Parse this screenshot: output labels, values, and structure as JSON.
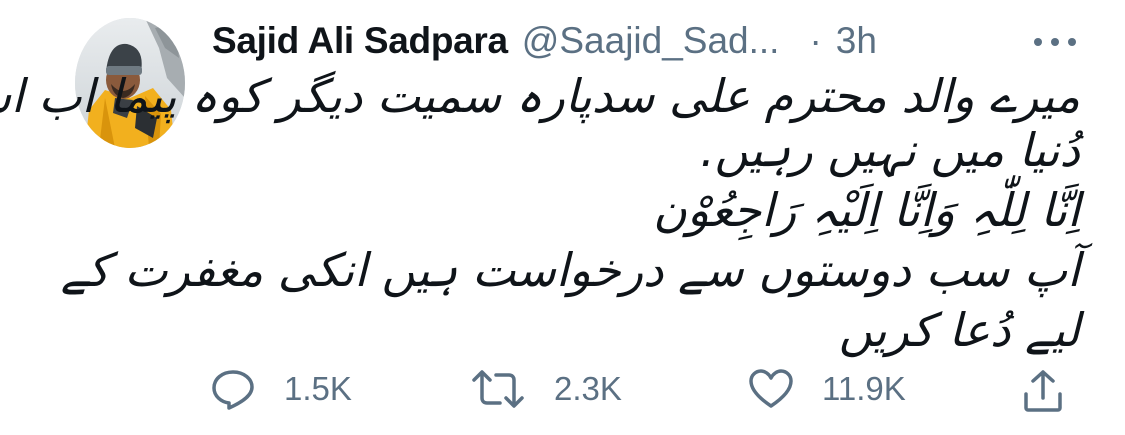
{
  "author": {
    "name": "Sajid Ali Sadpara",
    "handle": "@Saajid_Sad...",
    "separator": "·",
    "time": "3h"
  },
  "more": {
    "icon": "more-icon",
    "label": "•••"
  },
  "tweet": {
    "lines": [
      "میرے والد محترم علی سدپارہ سمیت دیگر کوہ پیما اب اس",
      "دُنیا میں نہیں رہیں.",
      "اِنَّا لِلّٰہِ وَاِنَّا اِلَیْہِ رَاجِعُوْن",
      "آپ سب دوستوں سے درخواست ہیں انکی مغفرت کے",
      "لیے دُعا کریں"
    ]
  },
  "actions": {
    "reply": {
      "icon": "reply-icon",
      "count": "1.5K"
    },
    "retweet": {
      "icon": "retweet-icon",
      "count": "2.3K"
    },
    "like": {
      "icon": "heart-icon",
      "count": "11.9K"
    },
    "share": {
      "icon": "share-icon"
    }
  },
  "colors": {
    "text": "#0f1419",
    "secondary": "#5b7083"
  }
}
